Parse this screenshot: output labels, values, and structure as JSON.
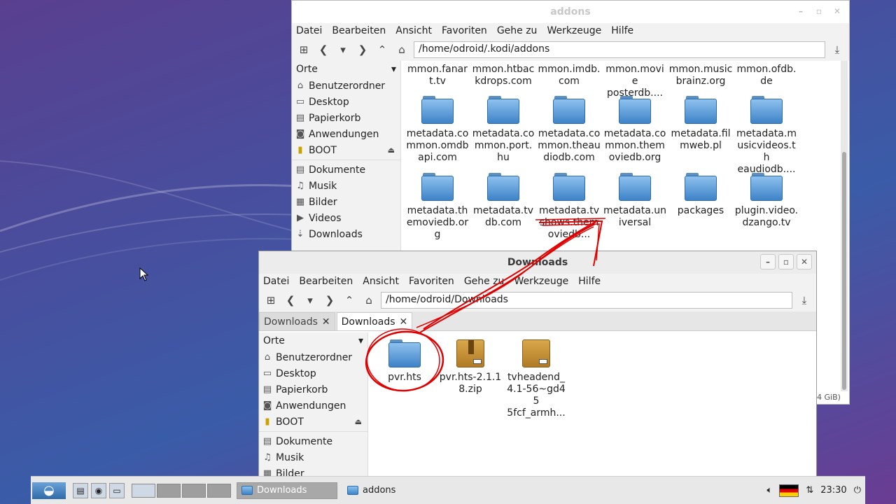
{
  "colors": {
    "desktop_accent": "#4a4c9c",
    "annotation_red": "#e00000",
    "folder_blue": "#3d83c7"
  },
  "addons_window": {
    "title": "addons",
    "menu": [
      "Datei",
      "Bearbeiten",
      "Ansicht",
      "Favoriten",
      "Gehe zu",
      "Werkzeuge",
      "Hilfe"
    ],
    "path": "/home/odroid/.kodi/addons",
    "sidebar": {
      "header": "Orte",
      "items": [
        {
          "icon": "home-icon",
          "label": "Benutzerordner"
        },
        {
          "icon": "desktop-icon",
          "label": "Desktop"
        },
        {
          "icon": "trash-icon",
          "label": "Papierkorb"
        },
        {
          "icon": "applications-icon",
          "label": "Anwendungen"
        },
        {
          "icon": "drive-icon",
          "label": "BOOT"
        },
        {
          "icon": "documents-icon",
          "label": "Dokumente"
        },
        {
          "icon": "music-icon",
          "label": "Musik"
        },
        {
          "icon": "pictures-icon",
          "label": "Bilder"
        },
        {
          "icon": "videos-icon",
          "label": "Videos"
        },
        {
          "icon": "downloads-icon",
          "label": "Downloads"
        }
      ]
    },
    "top_row": [
      "mmon.fanar\nt.tv",
      "mmon.htbac\nkdrops.com",
      "mmon.imdb.\ncom",
      "mmon.movie\nposterdb....",
      "mmon.music\nbrainz.org",
      "mmon.ofdb.\nde"
    ],
    "files": [
      "metadata.co\nmmon.omdb\napi.com",
      "metadata.co\nmmon.port.\nhu",
      "metadata.co\nmmon.theau\ndiodb.com",
      "metadata.co\nmmon.them\noviedb.org",
      "metadata.fil\nmweb.pl",
      "metadata.m\nusicvideos.th\neaudiodb....",
      "metadata.th\nemoviedb.or\ng",
      "metadata.tv\ndb.com",
      "metadata.tv\nshows.them\noviedb...",
      "metadata.un\niversal",
      "packages",
      "plugin.video.\ndzango.tv"
    ],
    "status_fragment": "4 GiB)"
  },
  "downloads_window": {
    "title": "Downloads",
    "menu": [
      "Datei",
      "Bearbeiten",
      "Ansicht",
      "Favoriten",
      "Gehe zu",
      "Werkzeuge",
      "Hilfe"
    ],
    "path": "/home/odroid/Downloads",
    "tabs": [
      {
        "label": "Downloads"
      },
      {
        "label": "Downloads"
      }
    ],
    "sidebar": {
      "header": "Orte",
      "items": [
        {
          "icon": "home-icon",
          "label": "Benutzerordner"
        },
        {
          "icon": "desktop-icon",
          "label": "Desktop"
        },
        {
          "icon": "trash-icon",
          "label": "Papierkorb"
        },
        {
          "icon": "applications-icon",
          "label": "Anwendungen"
        },
        {
          "icon": "drive-icon",
          "label": "BOOT"
        },
        {
          "icon": "documents-icon",
          "label": "Dokumente"
        },
        {
          "icon": "music-icon",
          "label": "Musik"
        },
        {
          "icon": "pictures-icon",
          "label": "Bilder"
        }
      ]
    },
    "files": [
      {
        "name": "pvr.hts",
        "kind": "folder"
      },
      {
        "name": "pvr.hts-2.1.1\n8.zip",
        "kind": "archive"
      },
      {
        "name": "tvheadend_\n4.1-56~gd45\n5fcf_armh...",
        "kind": "package"
      }
    ]
  },
  "taskbar": {
    "tasks": [
      {
        "label": "Downloads",
        "active": true
      },
      {
        "label": "addons",
        "active": false
      }
    ],
    "clock": "23:30"
  }
}
